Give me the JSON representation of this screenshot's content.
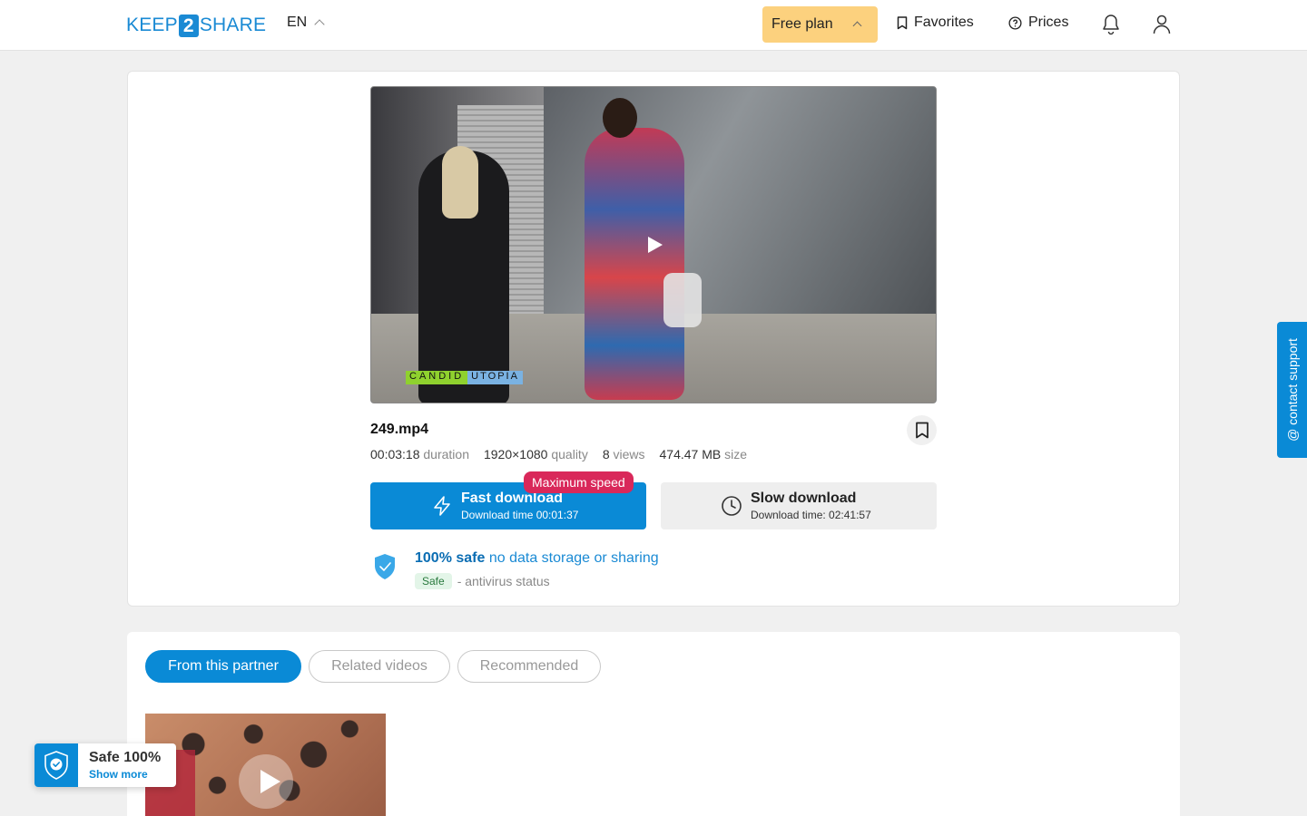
{
  "header": {
    "logo_left": "KEEP",
    "logo_mid": "2",
    "logo_right": "SHARE",
    "language": "EN",
    "plan_label": "Free plan",
    "favorites_label": "Favorites",
    "prices_label": "Prices"
  },
  "video": {
    "watermark_left": "CANDID",
    "watermark_right": "UTOPIA"
  },
  "file": {
    "name": "249.mp4",
    "duration_value": "00:03:18",
    "duration_label": "duration",
    "quality_value": "1920×1080",
    "quality_label": "quality",
    "views_value": "8",
    "views_label": "views",
    "size_value": "474.47 MB",
    "size_label": "size"
  },
  "download": {
    "fast_title": "Fast download",
    "fast_time": "Download time 00:01:37",
    "max_speed_badge": "Maximum speed",
    "slow_title": "Slow download",
    "slow_time": "Download time: 02:41:57"
  },
  "safety": {
    "headline_bold": "100% safe",
    "headline_rest": "no data storage or sharing",
    "badge": "Safe",
    "antivirus_text": "- antivirus status"
  },
  "support": {
    "label": "contact support"
  },
  "tabs": [
    {
      "label": "From this partner",
      "active": true
    },
    {
      "label": "Related videos",
      "active": false
    },
    {
      "label": "Recommended",
      "active": false
    }
  ],
  "toast": {
    "title": "Safe 100%",
    "link": "Show more"
  },
  "colors": {
    "accent": "#0a8ad6",
    "plan_bg": "#fcd17e",
    "badge_red": "#d9285a"
  }
}
